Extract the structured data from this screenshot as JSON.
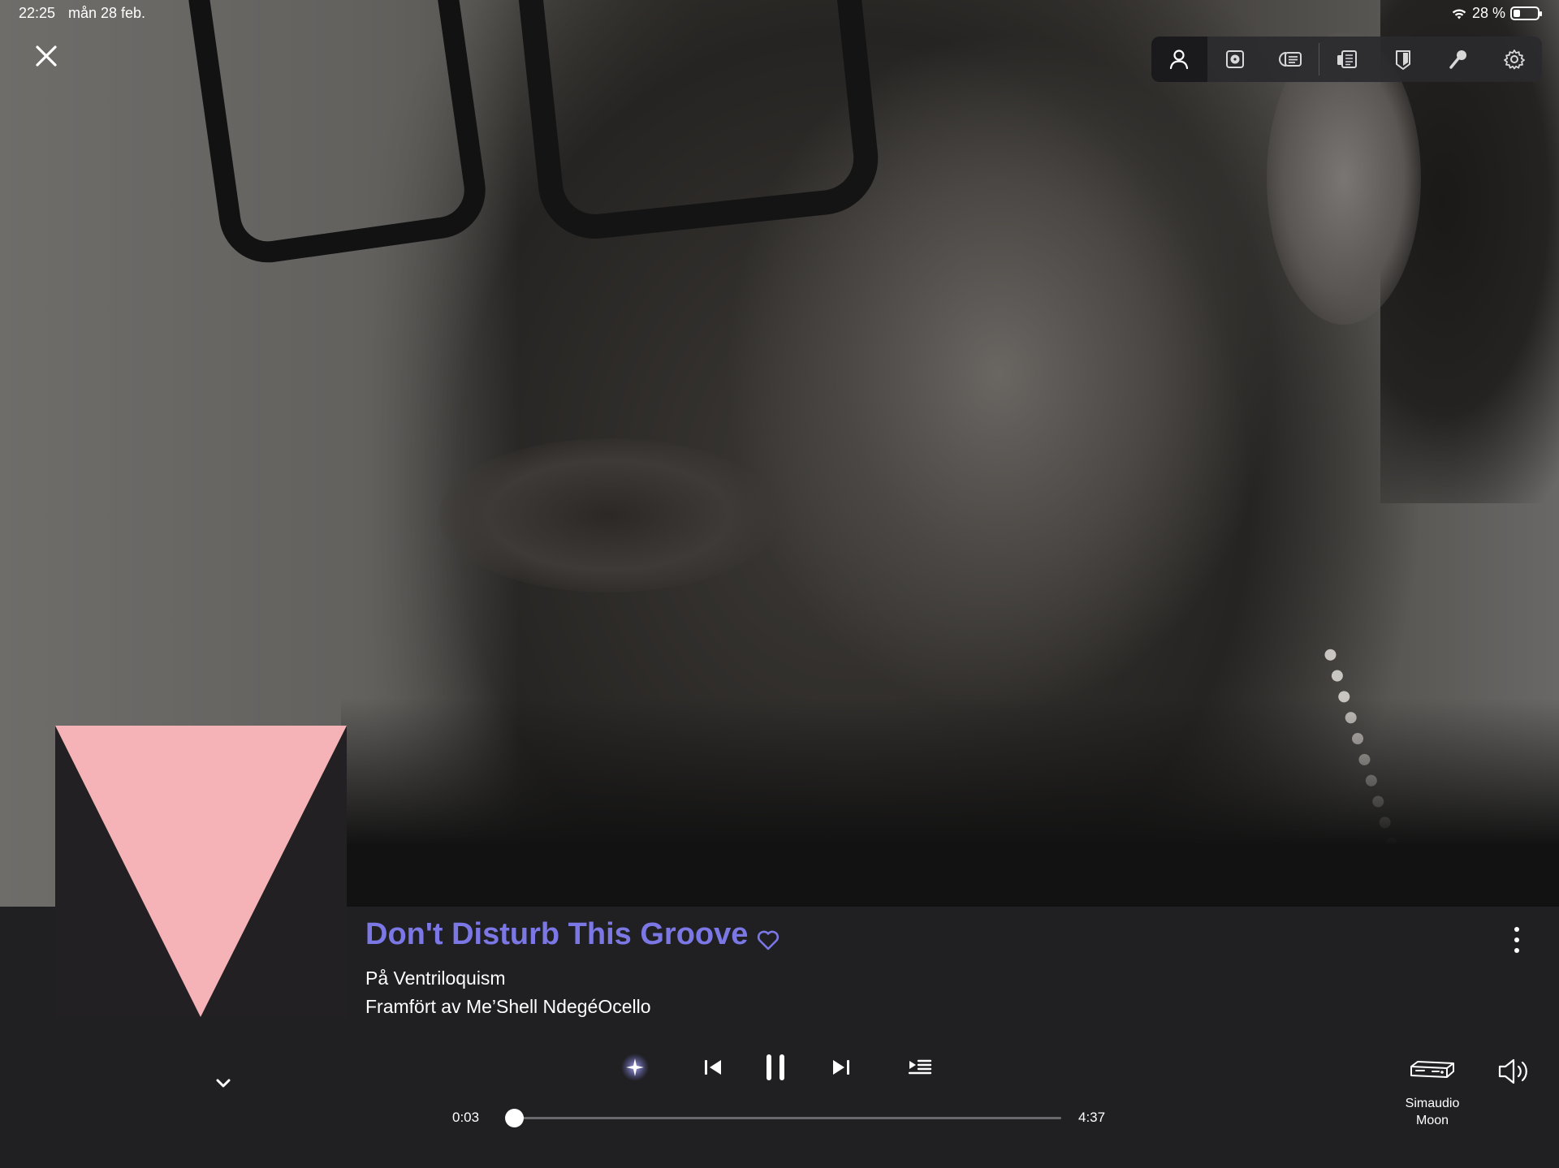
{
  "status_bar": {
    "time": "22:25",
    "date": "mån 28 feb.",
    "battery_text": "28 %",
    "battery_level": 0.28
  },
  "toolbar": {
    "buttons": [
      {
        "icon": "artist-icon",
        "active": true
      },
      {
        "icon": "album-icon",
        "active": false
      },
      {
        "icon": "credits-icon",
        "active": false
      },
      {
        "icon": "review-icon",
        "active": false
      },
      {
        "icon": "booklet-icon",
        "active": false
      },
      {
        "icon": "lyrics-icon",
        "active": false
      },
      {
        "icon": "gear-icon",
        "active": false
      }
    ]
  },
  "track": {
    "title": "Don't Disturb This Groove",
    "album_line": "På Ventriloquism",
    "artist_line": "Framfört av Me’Shell NdegéOcello"
  },
  "playback": {
    "elapsed": "0:03",
    "duration": "4:37",
    "progress": 0.011,
    "state": "playing"
  },
  "device": {
    "name": "Simaudio Moon"
  },
  "colors": {
    "accent": "#7b78e6",
    "background": "#202022",
    "album_triangle": "#f5b3b7",
    "album_background": "#222023"
  }
}
